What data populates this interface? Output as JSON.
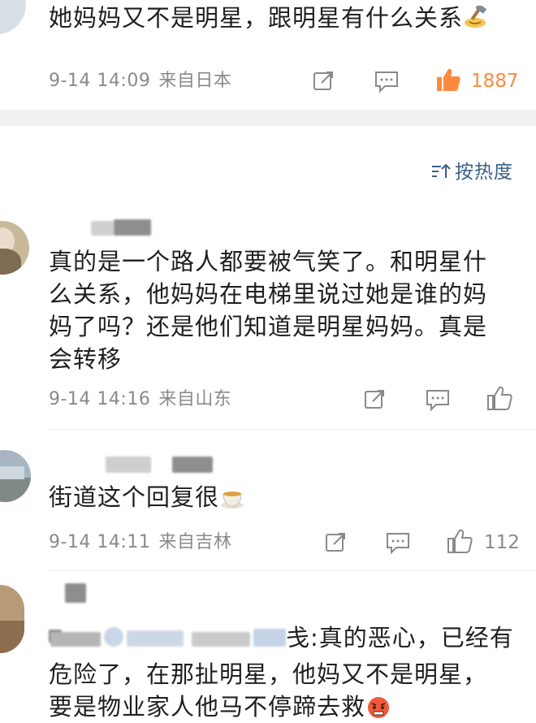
{
  "comments": [
    {
      "text": "她妈妈又不是明星，跟明星有什么关系",
      "date": "9-14 14:09",
      "location": "来自日本",
      "likes": "1887",
      "liked": true
    },
    {
      "text": "真的是一个路人都要被气笑了。和明星什么关系，他妈妈在电梯里说过她是谁的妈妈了吗？还是他们知道是明星妈妈。真是会转移",
      "lines": [
        "真的是一个路人都要被气笑了。和明星什",
        "么关系，他妈妈在电梯里说过她是谁的妈",
        "妈了吗？还是他们知道是明星妈妈。真是",
        "会转移"
      ],
      "date": "9-14 14:16",
      "location": "来自山东"
    },
    {
      "text": "街道这个回复很",
      "date": "9-14 14:11",
      "location": "来自吉林",
      "likes": "112"
    },
    {
      "reply_suffix": "戋:真的恶心，已经有",
      "lines": [
        "危险了，在那扯明星，他妈又不是明星，",
        "要是物业家人他马不停蹄去救"
      ]
    }
  ],
  "sort": {
    "label": "按热度"
  },
  "colors": {
    "like_active": "#ff8a3d",
    "meta": "#8a8a8a",
    "sort_link": "#3a5f86",
    "divider": "#f1f1f1"
  },
  "icons": [
    "hammer-emoji",
    "share-icon",
    "comment-icon",
    "like-icon",
    "sort-icon",
    "tea-emoji",
    "angry-emoji"
  ]
}
